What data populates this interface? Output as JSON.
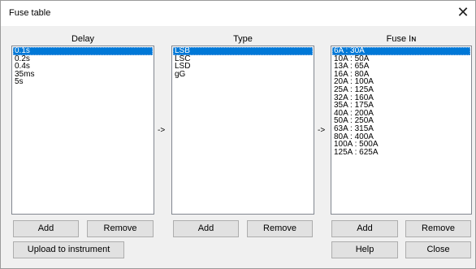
{
  "window": {
    "title": "Fuse table",
    "close_glyph": "✕"
  },
  "columns": {
    "delay": {
      "header": "Delay",
      "items": [
        "0.1s",
        "0.2s",
        "0.4s",
        "35ms",
        "5s"
      ],
      "selected_index": 0,
      "add_label": "Add",
      "remove_label": "Remove"
    },
    "type": {
      "header": "Type",
      "items": [
        "LSB",
        "LSC",
        "LSD",
        "gG"
      ],
      "selected_index": 0,
      "add_label": "Add",
      "remove_label": "Remove"
    },
    "fuse": {
      "header": "Fuse Iɴ",
      "items": [
        "6A : 30A",
        "10A : 50A",
        "13A : 65A",
        "16A : 80A",
        "20A : 100A",
        "25A : 125A",
        "32A : 160A",
        "35A : 175A",
        "40A : 200A",
        "50A : 250A",
        "63A : 315A",
        "80A : 400A",
        "100A : 500A",
        "125A : 625A"
      ],
      "selected_index": 0,
      "add_label": "Add",
      "remove_label": "Remove"
    }
  },
  "arrows": [
    "->",
    "->"
  ],
  "footer": {
    "upload_label": "Upload to instrument",
    "help_label": "Help",
    "close_label": "Close"
  },
  "colors": {
    "selection": "#0078d7",
    "button_face": "#e1e1e1"
  }
}
